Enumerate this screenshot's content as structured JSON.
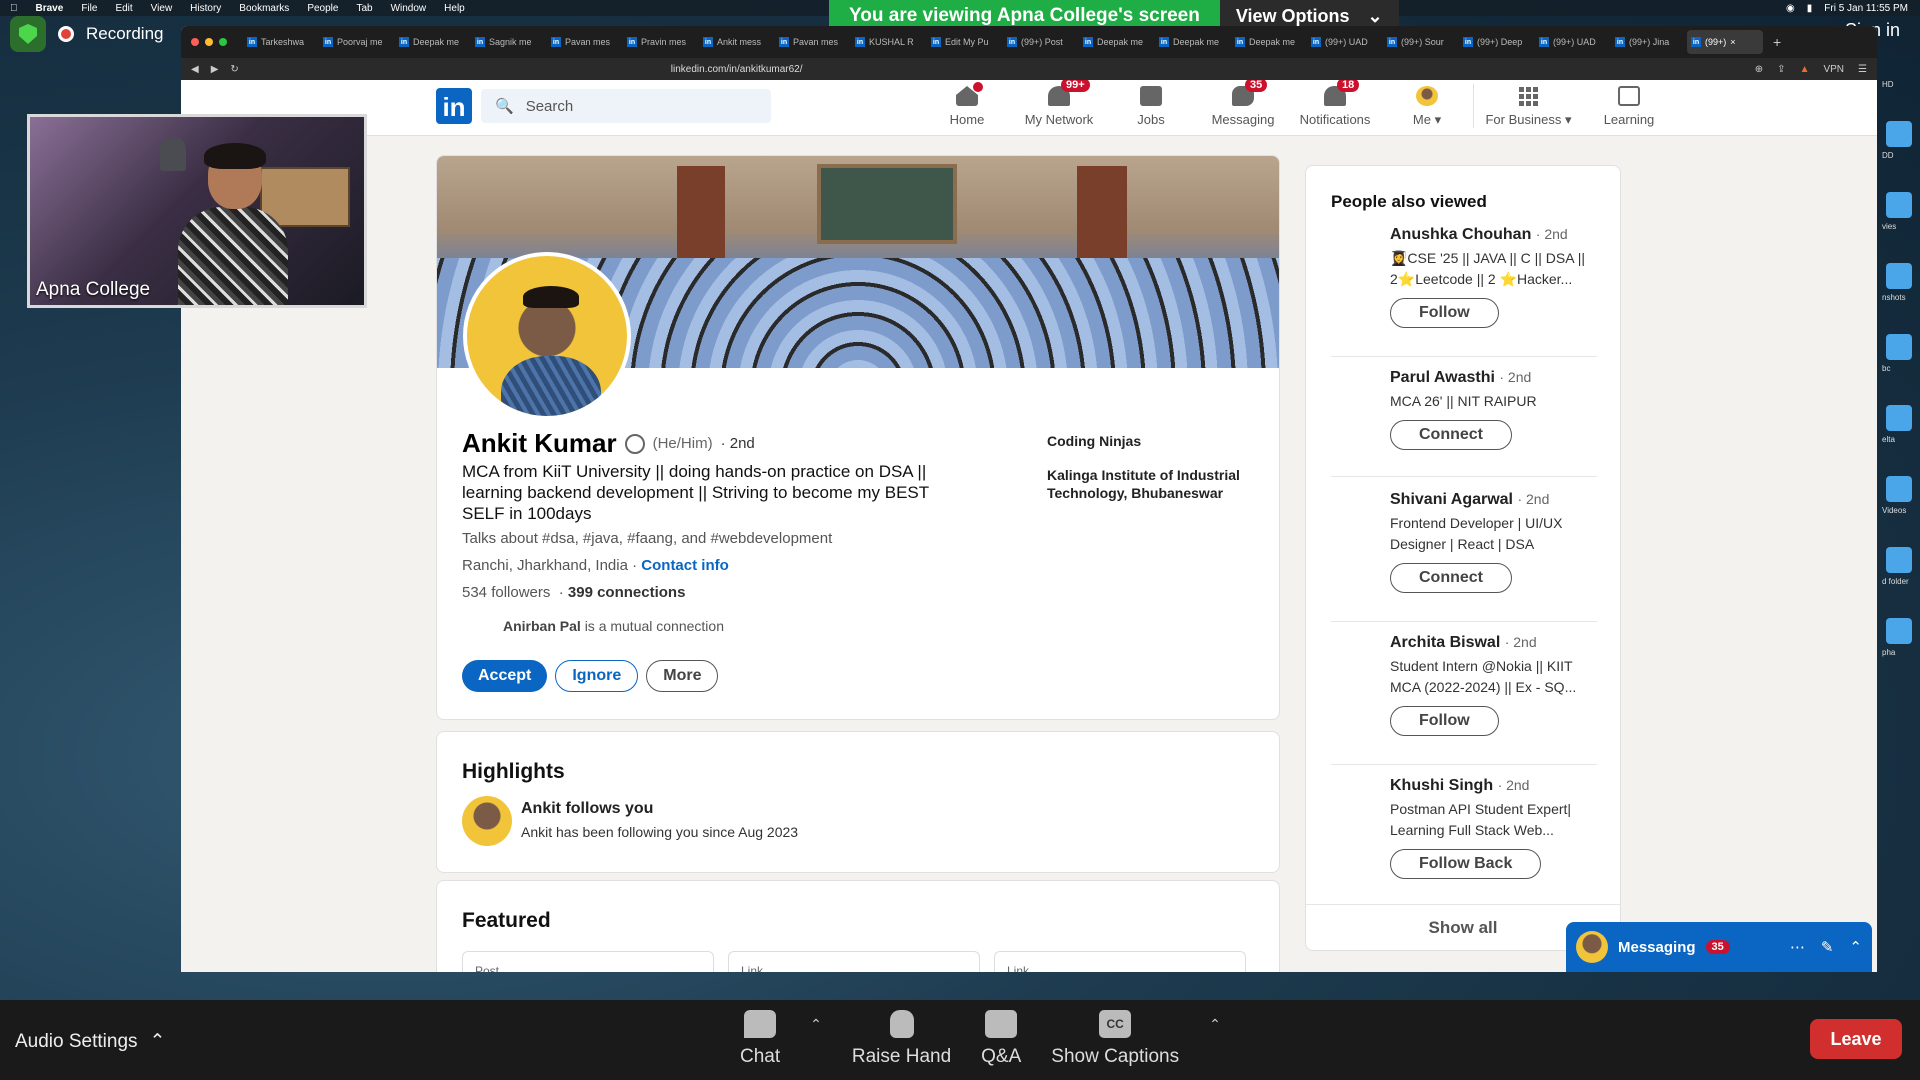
{
  "mac_menu": {
    "app": "Brave",
    "items": [
      "File",
      "Edit",
      "View",
      "History",
      "Bookmarks",
      "People",
      "Tab",
      "Window",
      "Help"
    ],
    "clock": "Fri 5 Jan  11:55 PM"
  },
  "zoom": {
    "recording": "Recording",
    "banner_text": "You are viewing Apna College's screen",
    "view_options": "View Options",
    "sign_in": "Sign in",
    "presenter_name": "Apna College",
    "toolbar": {
      "audio": "Audio Settings",
      "chat": "Chat",
      "raise_hand": "Raise Hand",
      "qa": "Q&A",
      "captions": "Show Captions",
      "cc": "CC",
      "leave": "Leave"
    }
  },
  "browser": {
    "url": "linkedin.com/in/ankitkumar62/",
    "tabs": [
      "Tarkeshwa",
      "Poorvaj me",
      "Deepak me",
      "Sagnik me",
      "Pavan mes",
      "Pravin mes",
      "Ankit mess",
      "Pavan mes",
      "KUSHAL R",
      "Edit My Pu",
      "(99+) Post",
      "Deepak me",
      "Deepak me",
      "Deepak me",
      "(99+) UAD",
      "(99+) Sour",
      "(99+) Deep",
      "(99+) UAD",
      "(99+) Jina",
      "(99+)"
    ],
    "vpn": "VPN"
  },
  "linkedin": {
    "search_placeholder": "Search",
    "nav": [
      {
        "label": "Home",
        "badge": ""
      },
      {
        "label": "My Network",
        "badge": "99+"
      },
      {
        "label": "Jobs",
        "badge": ""
      },
      {
        "label": "Messaging",
        "badge": "35"
      },
      {
        "label": "Notifications",
        "badge": "18"
      },
      {
        "label": "Me",
        "badge": ""
      },
      {
        "label": "For Business",
        "badge": ""
      },
      {
        "label": "Learning",
        "badge": ""
      }
    ],
    "profile": {
      "name": "Ankit Kumar",
      "pronouns": "(He/Him)",
      "degree": "· 2nd",
      "headline": "MCA from KiiT University || doing hands-on practice on DSA || learning backend development || Striving to become my BEST SELF in 100days",
      "talks": "Talks about #dsa, #java, #faang, and #webdevelopment",
      "location": "Ranchi, Jharkhand, India ·",
      "contact": "Contact info",
      "followers": "534 followers",
      "connections": "399 connections",
      "mutual_name": "Anirban Pal",
      "mutual_suffix": "is a mutual connection",
      "accept": "Accept",
      "ignore": "Ignore",
      "more": "More",
      "company": "Coding Ninjas",
      "school": "Kalinga Institute of Industrial Technology, Bhubaneswar"
    },
    "highlights": {
      "title": "Highlights",
      "item_title": "Ankit follows you",
      "item_sub": "Ankit has been following you since Aug 2023"
    },
    "featured": {
      "title": "Featured",
      "items": [
        "Post",
        "Link",
        "Link"
      ]
    },
    "people_also_viewed": {
      "title": "People also viewed",
      "people": [
        {
          "name": "Anushka Chouhan",
          "degree": "· 2nd",
          "desc": "👩‍🎓CSE '25 || JAVA || C || DSA || 2⭐Leetcode || 2 ⭐Hacker...",
          "button": "Follow"
        },
        {
          "name": "Parul Awasthi",
          "degree": "· 2nd",
          "desc": "MCA 26' || NIT RAIPUR",
          "button": "Connect"
        },
        {
          "name": "Shivani Agarwal",
          "degree": "· 2nd",
          "desc": "Frontend Developer | UI/UX Designer | React | DSA",
          "button": "Connect"
        },
        {
          "name": "Archita Biswal",
          "degree": "· 2nd",
          "desc": "Student Intern @Nokia || KIIT MCA (2022-2024) || Ex - SQ...",
          "button": "Follow"
        },
        {
          "name": "Khushi Singh",
          "degree": "· 2nd",
          "desc": "Postman API Student Expert| Learning Full Stack Web...",
          "button": "Follow Back"
        }
      ],
      "show_all": "Show all"
    },
    "messaging": {
      "label": "Messaging",
      "badge": "35"
    }
  },
  "dock_labels": [
    "HD",
    "DD",
    "vies",
    "nshots",
    "bc",
    "elta",
    "Videos",
    "d folder",
    "pha"
  ]
}
